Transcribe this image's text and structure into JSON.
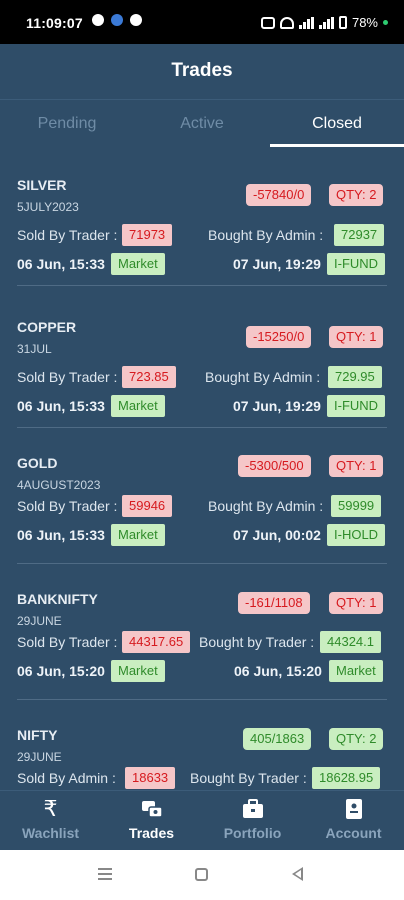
{
  "status_bar": {
    "time": "11:09:07",
    "battery": "78%"
  },
  "header": {
    "title": "Trades"
  },
  "tabs": [
    {
      "label": "Pending",
      "active": false
    },
    {
      "label": "Active",
      "active": false
    },
    {
      "label": "Closed",
      "active": true
    }
  ],
  "trades": [
    {
      "symbol": "SILVER",
      "expiry": "5JULY2023",
      "pnl": "-57840/0",
      "pnl_color": "red",
      "qty": "QTY: 2",
      "qty_color": "red",
      "left_label": "Sold By Trader :",
      "left_price": "71973",
      "left_price_color": "red",
      "right_label": "Bought By Admin :",
      "right_price": "72937",
      "right_price_color": "green",
      "left_time": "06 Jun, 15:33",
      "left_tag": "Market",
      "right_time": "07 Jun, 19:29",
      "right_tag": "I-FUND"
    },
    {
      "symbol": "COPPER",
      "expiry": "31JUL",
      "pnl": "-15250/0",
      "pnl_color": "red",
      "qty": "QTY: 1",
      "qty_color": "red",
      "left_label": "Sold By Trader :",
      "left_price": "723.85",
      "left_price_color": "red",
      "right_label": "Bought By Admin :",
      "right_price": "729.95",
      "right_price_color": "green",
      "left_time": "06 Jun, 15:33",
      "left_tag": "Market",
      "right_time": "07 Jun, 19:29",
      "right_tag": "I-FUND"
    },
    {
      "symbol": "GOLD",
      "expiry": "4AUGUST2023",
      "pnl": "-5300/500",
      "pnl_color": "red",
      "qty": "QTY: 1",
      "qty_color": "red",
      "left_label": "Sold By Trader :",
      "left_price": "59946",
      "left_price_color": "red",
      "right_label": "Bought By Admin :",
      "right_price": "59999",
      "right_price_color": "green",
      "left_time": "06 Jun, 15:33",
      "left_tag": "Market",
      "right_time": "07 Jun, 00:02",
      "right_tag": "I-HOLD"
    },
    {
      "symbol": "BANKNIFTY",
      "expiry": "29JUNE",
      "pnl": "-161/1108",
      "pnl_color": "red",
      "qty": "QTY: 1",
      "qty_color": "red",
      "left_label": "Sold By Trader :",
      "left_price": "44317.65",
      "left_price_color": "red",
      "right_label": "Bought by Trader :",
      "right_price": "44324.1",
      "right_price_color": "green",
      "left_time": "06 Jun, 15:20",
      "left_tag": "Market",
      "right_time": "06 Jun, 15:20",
      "right_tag": "Market"
    },
    {
      "symbol": "NIFTY",
      "expiry": "29JUNE",
      "pnl": "405/1863",
      "pnl_color": "green",
      "qty": "QTY: 2",
      "qty_color": "green",
      "left_label": "Sold By Admin :",
      "left_price": "18633",
      "left_price_color": "red",
      "right_label": "Bought By Trader :",
      "right_price": "18628.95",
      "right_price_color": "green",
      "left_time": "",
      "left_tag": "",
      "right_time": "",
      "right_tag": ""
    }
  ],
  "bottom_nav": [
    {
      "label": "Wachlist",
      "icon": "rupee-icon",
      "active": false
    },
    {
      "label": "Trades",
      "icon": "trades-icon",
      "active": true
    },
    {
      "label": "Portfolio",
      "icon": "briefcase-icon",
      "active": false
    },
    {
      "label": "Account",
      "icon": "account-icon",
      "active": false
    }
  ]
}
